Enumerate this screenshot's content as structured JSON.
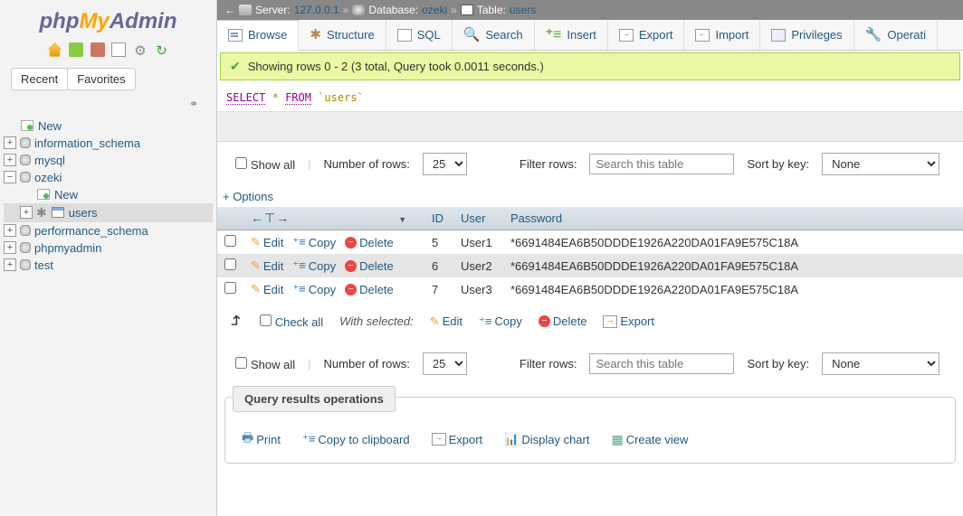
{
  "logo": {
    "php": "php",
    "my": "My",
    "admin": "Admin"
  },
  "sidebar_tabs": {
    "recent": "Recent",
    "favorites": "Favorites"
  },
  "tree": {
    "new": "New",
    "information_schema": "information_schema",
    "mysql": "mysql",
    "ozeki": "ozeki",
    "ozeki_new": "New",
    "users": "users",
    "performance_schema": "performance_schema",
    "phpmyadmin": "phpmyadmin",
    "test": "test"
  },
  "breadcrumb": {
    "server_label": "Server:",
    "server": "127.0.0.1",
    "db_label": "Database:",
    "db": "ozeki",
    "table_label": "Table:",
    "table": "users"
  },
  "tabs": {
    "browse": "Browse",
    "structure": "Structure",
    "sql": "SQL",
    "search": "Search",
    "insert": "Insert",
    "export": "Export",
    "import": "Import",
    "privileges": "Privileges",
    "operations": "Operati"
  },
  "success": "Showing rows 0 - 2 (3 total, Query took 0.0011 seconds.)",
  "sql": {
    "select": "SELECT",
    "star": "*",
    "from": "FROM",
    "table": "`users`"
  },
  "controls": {
    "show_all": "Show all",
    "num_rows": "Number of rows:",
    "num_rows_val": "25",
    "filter": "Filter rows:",
    "search_placeholder": "Search this table",
    "sort": "Sort by key:",
    "sort_val": "None"
  },
  "options": "+ Options",
  "cols": {
    "id": "ID",
    "user": "User",
    "password": "Password"
  },
  "row_actions": {
    "edit": "Edit",
    "copy": "Copy",
    "delete": "Delete"
  },
  "rows": [
    {
      "id": "5",
      "user": "User1",
      "password": "*6691484EA6B50DDDE1926A220DA01FA9E575C18A"
    },
    {
      "id": "6",
      "user": "User2",
      "password": "*6691484EA6B50DDDE1926A220DA01FA9E575C18A"
    },
    {
      "id": "7",
      "user": "User3",
      "password": "*6691484EA6B50DDDE1926A220DA01FA9E575C18A"
    }
  ],
  "bulk": {
    "check_all": "Check all",
    "with_selected": "With selected:",
    "edit": "Edit",
    "copy": "Copy",
    "delete": "Delete",
    "export": "Export"
  },
  "panel": {
    "title": "Query results operations",
    "print": "Print",
    "clipboard": "Copy to clipboard",
    "export": "Export",
    "chart": "Display chart",
    "view": "Create view"
  }
}
